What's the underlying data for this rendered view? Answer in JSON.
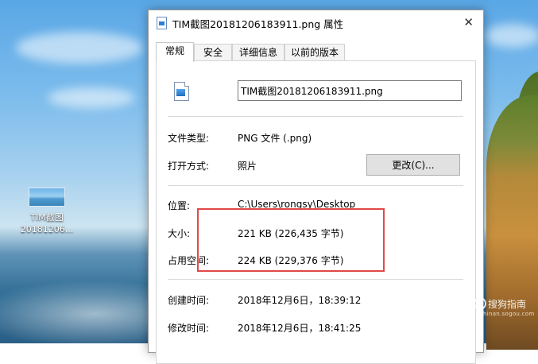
{
  "desktop": {
    "icon_label_line1": "TIM截图",
    "icon_label_line2": "20181206..."
  },
  "dialog": {
    "title": "TIM截图20181206183911.png 属性",
    "tabs": [
      {
        "label": "常规",
        "active": true
      },
      {
        "label": "安全",
        "active": false
      },
      {
        "label": "详细信息",
        "active": false
      },
      {
        "label": "以前的版本",
        "active": false
      }
    ],
    "filename": "TIM截图20181206183911.png",
    "file_type_label": "文件类型:",
    "file_type_value": "PNG 文件 (.png)",
    "open_with_label": "打开方式:",
    "open_with_value": "照片",
    "change_button": "更改(C)...",
    "location_label": "位置:",
    "location_value": "C:\\Users\\rongsy\\Desktop",
    "size_label": "大小:",
    "size_value": "221 KB (226,435 字节)",
    "disk_size_label": "占用空间:",
    "disk_size_value": "224 KB (229,376 字节)",
    "created_label": "创建时间:",
    "created_value": "2018年12月6日，18:39:12",
    "modified_label": "修改时间:",
    "modified_value": "2018年12月6日，18:41:25"
  },
  "watermark": {
    "text": "搜狗指南",
    "subtext": "zhinan.sogou.com"
  },
  "colors": {
    "highlight": "#e24848",
    "accent": "#2d7fd1"
  }
}
